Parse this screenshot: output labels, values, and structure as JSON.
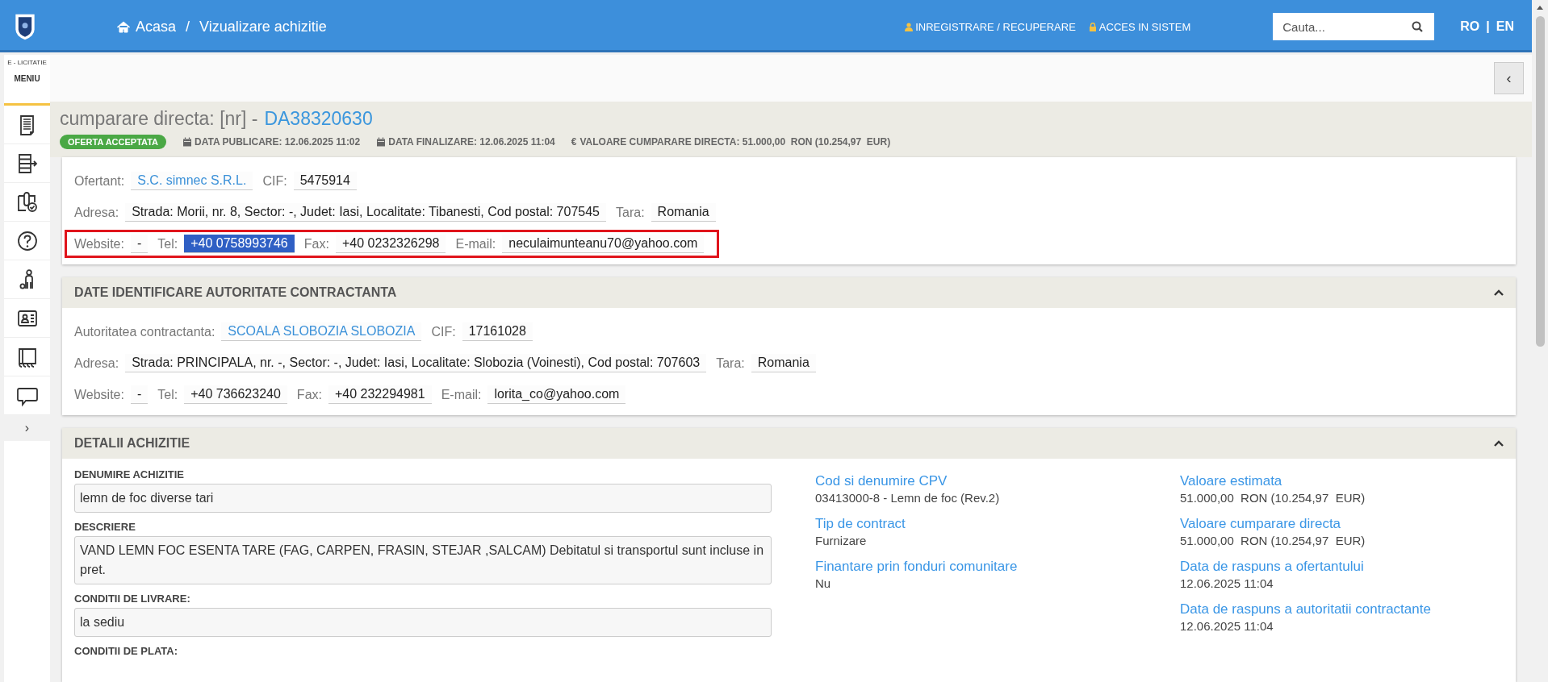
{
  "topbar": {
    "breadcrumb": [
      {
        "text": "Acasa",
        "kind": "home"
      },
      {
        "text": "Vizualizare achizitie",
        "kind": "current"
      }
    ],
    "separator": "/",
    "links": [
      {
        "text": "INREGISTRARE / RECUPERARE",
        "kind": "user"
      },
      {
        "text": "ACCES IN SISTEM",
        "kind": "lock"
      }
    ],
    "search": {
      "placeholder": "Cauta..."
    },
    "languages": [
      "RO",
      "EN"
    ],
    "language_separator": "|"
  },
  "sidebar": {
    "brand": "E - LICITATIE",
    "menu_label": "MENIU",
    "expand": "›"
  },
  "toolbar": {
    "collapse": "‹"
  },
  "header": {
    "title": "cumparare directa: [nr] -",
    "code": "DA38320630",
    "status": {
      "text": "OFERTA ACCEPTATA",
      "kind": "success"
    },
    "meta": [
      {
        "kind": "date",
        "text": "DATA PUBLICARE: 12.06.2025 11:02"
      },
      {
        "kind": "date",
        "text": "DATA FINALIZARE: 12.06.2025 11:04"
      },
      {
        "kind": "currency",
        "symbol": "€",
        "text": "VALOARE CUMPARARE DIRECTA: 51.000,00  RON (10.254,97  EUR)"
      }
    ]
  },
  "offerer": {
    "rows": [
      {
        "outlined": false,
        "fields": [
          {
            "label": "Ofertant:",
            "value": "S.C. simnec S.R.L.",
            "kind": "link"
          },
          {
            "label": "CIF:",
            "value": "5475914",
            "kind": "text"
          }
        ]
      },
      {
        "outlined": false,
        "fields": [
          {
            "label": "Adresa:",
            "value": "Strada: Morii, nr. 8, Sector: -, Judet: Iasi, Localitate: Tibanesti, Cod postal: 707545",
            "kind": "text"
          },
          {
            "label": "Tara:",
            "value": "Romania",
            "kind": "text"
          }
        ]
      },
      {
        "outlined": true,
        "fields": [
          {
            "label": "Website:",
            "value": "-",
            "kind": "text"
          },
          {
            "label": "Tel:",
            "value": "+40 0758993746",
            "kind": "highlighted"
          },
          {
            "label": "Fax:",
            "value": "+40 0232326298",
            "kind": "text"
          },
          {
            "label": "E-mail:",
            "value": "neculaimunteanu70@yahoo.com",
            "kind": "text"
          }
        ]
      }
    ]
  },
  "authority": {
    "title": "DATE IDENTIFICARE AUTORITATE CONTRACTANTA",
    "expanded": true,
    "rows": [
      {
        "outlined": false,
        "fields": [
          {
            "label": "Autoritatea contractanta:",
            "value": "SCOALA SLOBOZIA SLOBOZIA",
            "kind": "link"
          },
          {
            "label": "CIF:",
            "value": "17161028",
            "kind": "text"
          }
        ]
      },
      {
        "outlined": false,
        "fields": [
          {
            "label": "Adresa:",
            "value": "Strada: PRINCIPALA, nr. -, Sector: -, Judet: Iasi, Localitate: Slobozia (Voinesti), Cod postal: 707603",
            "kind": "text"
          },
          {
            "label": "Tara:",
            "value": "Romania",
            "kind": "text"
          }
        ]
      },
      {
        "outlined": false,
        "fields": [
          {
            "label": "Website:",
            "value": "-",
            "kind": "text"
          },
          {
            "label": "Tel:",
            "value": "+40 736623240",
            "kind": "text"
          },
          {
            "label": "Fax:",
            "value": "+40 232294981",
            "kind": "text"
          },
          {
            "label": "E-mail:",
            "value": "lorita_co@yahoo.com",
            "kind": "text"
          }
        ]
      }
    ]
  },
  "details": {
    "title": "DETALII ACHIZITIE",
    "expanded": true,
    "fields": [
      {
        "label": "DENUMIRE ACHIZITIE",
        "value": "lemn de foc diverse tari"
      },
      {
        "label": "DESCRIERE",
        "value": "VAND LEMN FOC ESENTA TARE (FAG, CARPEN, FRASIN, STEJAR ,SALCAM) Debitatul si transportul sunt incluse in pret."
      },
      {
        "label": "CONDITII DE LIVRARE:",
        "value": "la sediu"
      },
      {
        "label": "CONDITII DE PLATA:"
      }
    ],
    "column_2": [
      {
        "label": "Cod si denumire CPV",
        "value": "03413000-8 - Lemn de foc (Rev.2)"
      },
      {
        "label": "Tip de contract",
        "value": "Furnizare"
      },
      {
        "label": "Finantare prin fonduri comunitare",
        "value": "Nu"
      }
    ],
    "column_3": [
      {
        "label": "Valoare estimata",
        "value": "51.000,00  RON (10.254,97  EUR)"
      },
      {
        "label": "Valoare cumparare directa",
        "value": "51.000,00  RON (10.254,97  EUR)"
      },
      {
        "label": "Data de raspuns a ofertantului",
        "value": "12.06.2025 11:04"
      },
      {
        "label": "Data de raspuns a autoritatii contractante",
        "value": "12.06.2025 11:04"
      }
    ]
  }
}
